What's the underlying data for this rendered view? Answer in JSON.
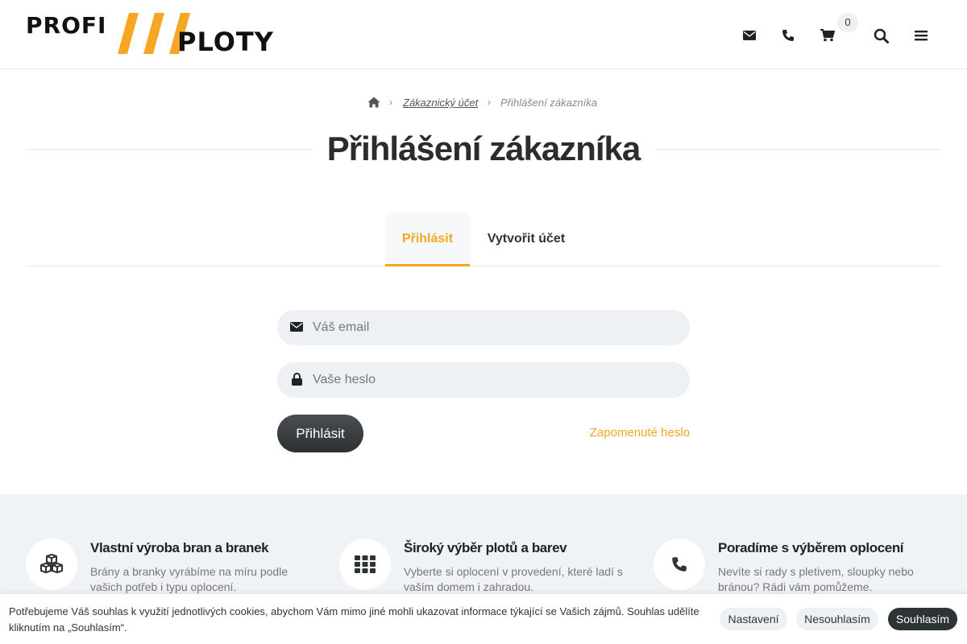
{
  "logo": {
    "word1": "PROFI",
    "word2": "PLOTY",
    "slashes": "///",
    "brand_color": "#f5a623"
  },
  "header": {
    "icons": [
      "envelope-icon",
      "phone-icon",
      "cart-icon",
      "search-icon",
      "menu-icon"
    ],
    "cart_count": "0"
  },
  "breadcrumb": {
    "home_icon": "home-icon",
    "items": [
      {
        "label": "Zákaznický účet"
      },
      {
        "label": "Přihlášení zákazníka"
      }
    ]
  },
  "page": {
    "title": "Přihlášení zákazníka"
  },
  "tabs": [
    {
      "label": "Přihlásit",
      "active": true
    },
    {
      "label": "Vytvořit účet",
      "active": false
    }
  ],
  "form": {
    "email_placeholder": "Váš email",
    "email_value": "",
    "password_placeholder": "Vaše heslo",
    "password_value": "",
    "submit_label": "Přihlásit",
    "forgot_label": "Zapomenuté heslo"
  },
  "features": [
    {
      "icon": "cubes-icon",
      "title": "Vlastní výroba bran a branek",
      "text": "Brány a branky vyrábíme na míru podle vašich potřeb i typu oplocení."
    },
    {
      "icon": "grid-icon",
      "title": "Široký výběr plotů a barev",
      "text": "Vyberte si oplocení v provedení, které ladí s vaším domem i zahradou."
    },
    {
      "icon": "phone-icon",
      "title": "Poradíme s výběrem oplocení",
      "text": "Nevíte si rady s pletivem, sloupky nebo bránou? Rádi vám pomůžeme."
    }
  ],
  "cookie_bar": {
    "text": "Potřebujeme Váš souhlas k využití jednotlivých cookies, abychom Vám mimo jiné mohli ukazovat informace týkající se Vašich zájmů. Souhlas udělíte kliknutím na „Souhlasím“.",
    "settings_label": "Nastavení",
    "reject_label": "Nesouhlasím",
    "accept_label": "Souhlasím"
  },
  "colors": {
    "accent": "#f5a623",
    "dark_button": "#2e3336",
    "band_bg": "#f0f3f5",
    "field_bg": "#eef1f3"
  }
}
